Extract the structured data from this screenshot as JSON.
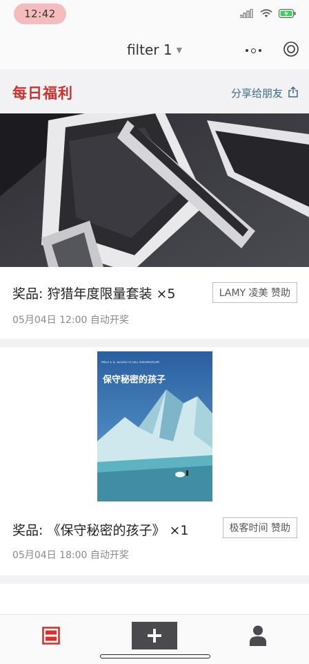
{
  "status_bar": {
    "time": "12:42",
    "icons": [
      "signal-icon",
      "wifi-icon",
      "battery-charging-icon"
    ]
  },
  "nav": {
    "title": "filter 1",
    "caret_icon": "caret-down-icon",
    "more_icon": "more-dots-icon",
    "target_icon": "record-target-icon"
  },
  "header": {
    "title": "每日福利",
    "share_label": "分享给朋友",
    "share_icon": "share-icon",
    "title_color": "#c8332e",
    "share_color": "#3d6a88"
  },
  "giveaways": [
    {
      "image_name": "pen-set-photo",
      "prize": "奖品: 狩猎年度限量套装 ×5",
      "sponsor": "LAMY 凌美 赞助",
      "draw_time": "05月04日 12:00 自动开奖"
    },
    {
      "image_name": "book-cover",
      "book_series_text": "MILO E IL SEGRETO DEL KARAKORUM",
      "book_title": "保守秘密的孩子",
      "prize": "奖品: 《保守秘密的孩子》 ×1",
      "sponsor": "极客时间 赞助",
      "draw_time": "05月04日 18:00 自动开奖"
    }
  ],
  "tab_bar": {
    "tabs": [
      {
        "name": "home-tab",
        "icon": "feed-icon",
        "active": true
      },
      {
        "name": "add-tab",
        "icon": "plus-icon",
        "active": false
      },
      {
        "name": "profile-tab",
        "icon": "person-icon",
        "active": false
      }
    ],
    "active_color": "#d6322d"
  }
}
